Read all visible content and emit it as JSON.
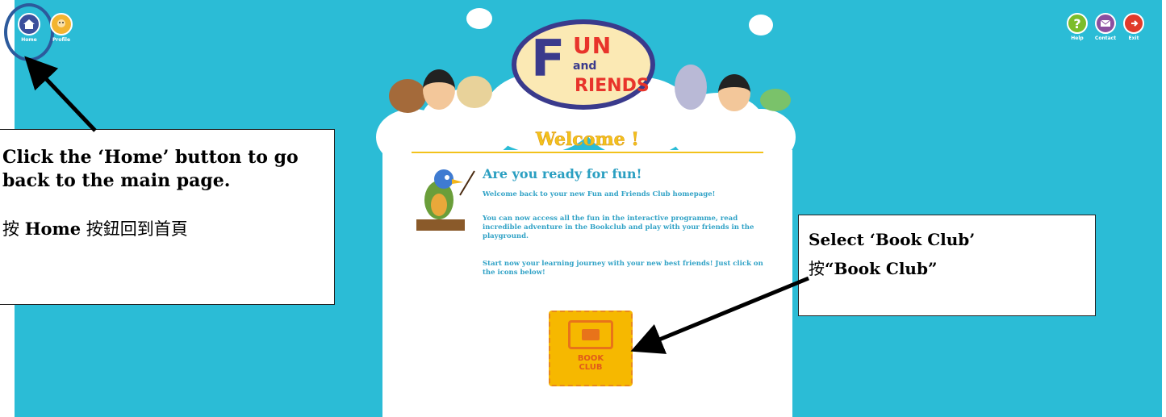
{
  "nav": {
    "home_label": "Home",
    "profile_label": "Profile"
  },
  "top_right": {
    "help_label": "Help",
    "contact_label": "Contact",
    "exit_label": "Exit"
  },
  "logo": {
    "f": "F",
    "un": "UN",
    "and": "and",
    "riends": "RIENDS"
  },
  "panel": {
    "welcome": "Welcome !",
    "heading": "Are you ready for fun!",
    "para1": "Welcome back to your new Fun and Friends Club homepage!",
    "para2": "You can now access all the fun in the interactive programme, read incredible adventure in the Bookclub and play with your friends in the playground.",
    "para3": "Start now your learning journey with your new best friends! Just click on the icons below!",
    "book_club_line1": "BOOK",
    "book_club_line2": "CLUB"
  },
  "callout_left": {
    "en": "Click the ‘Home’ button to go back to the main page.",
    "zh_prefix": "按 ",
    "zh_bold": "Home",
    "zh_suffix": " 按鈕回到首頁"
  },
  "callout_right": {
    "en": "Select ‘Book Club’",
    "zh_prefix": "按",
    "zh_bold": "“Book Club”"
  },
  "colors": {
    "sky": "#2bbcd6",
    "logo_navy": "#3a3a8c",
    "logo_red": "#e8342b",
    "welcome_yellow": "#f2c21b",
    "text_blue": "#30a2c6",
    "book_club_yellow": "#f6b800",
    "home_ring": "#2c5a9c"
  }
}
